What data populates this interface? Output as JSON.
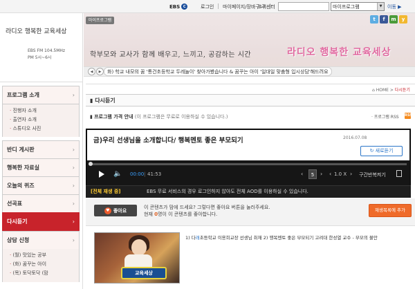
{
  "topbar": {
    "logo": "EBS",
    "links": [
      "로그인",
      "마이페이지/장바구니",
      "고객센터"
    ],
    "program_select": "마이프로그램",
    "go_label": "이동"
  },
  "brand": {
    "title": "라디오 행복한 교육세상",
    "freq_line1": "EBS FM 104.5MHz",
    "freq_line2": "PM 5시~6시"
  },
  "banner": {
    "tag": "마이프로그램",
    "slogan": "학부모와 교사가 함께 배우고, 느끼고, 공감하는 시간",
    "title": "라디오 행복한 교육세상",
    "ticker": "화) 학교 내모의 꿈 '통건초등학교 두레놀이' 찾아가봤습니다 & 꿈꾸는 아이 '일대일 맞춤형 입시상담'해드려요"
  },
  "sidebar": {
    "sections": [
      {
        "label": "프로그램 소개",
        "items": [
          "진행자 소개",
          "출연자 소개",
          "스튜디오 사진"
        ]
      },
      {
        "label": "반디 게시판",
        "items": []
      },
      {
        "label": "행복한 자료실",
        "items": []
      },
      {
        "label": "오늘의 퀴즈",
        "items": []
      },
      {
        "label": "선곡표",
        "items": []
      },
      {
        "label": "다시듣기",
        "items": []
      },
      {
        "label": "상담 신청",
        "items": [
          "(월) 맛있는 공부",
          "(화) 꿈꾸는 아이",
          "(목) 토닥토닥 (맘"
        ]
      }
    ],
    "active": "다시듣기"
  },
  "main": {
    "breadcrumb_home": "HOME",
    "breadcrumb_current": "다시듣기",
    "page_title": "다시듣기",
    "price_bold": "프로그램 가격 안내",
    "price_note": "(이 프로그램은 무료로 이용하실 수 있습니다.)",
    "rss_label": "· 프로그램 RSS",
    "rss_icon": "RSS"
  },
  "player": {
    "episode_title": "금)우리 선생님을 소개합니다/ 행복멘토 좋은 부모되기",
    "date": "2016.07.08",
    "refresh_label": "새로듣기",
    "time_current": "00:00",
    "time_total": "41:53",
    "rate_value": "5",
    "speed": "1.0 X",
    "loop_label": "구간반복켜기",
    "progress_fraction": 0.0
  },
  "notice": {
    "strong": "[전체 재생 중]",
    "text": "EBS 무료 서비스의 경우 로그인하지 않아도 전체 AOD를 이용하실 수 있습니다."
  },
  "like": {
    "button_label": "좋아요",
    "line1": "이 콘텐츠가 맘에 드세요? 그렇다면 좋아요 버튼을 눌러주세요.",
    "line2_pre": "현재",
    "line2_count": "0",
    "line2_post": "명이 이 콘텐츠를 좋아합니다.",
    "add_playlist": "재생목록에 추가"
  },
  "video": {
    "sign_text": "교육세상",
    "title_pre": "1) 다",
    "title_hl": "래",
    "title_post": "초등학교 이용희교장 선생님 취재 2) 행복멘토 좋은 부모되기 고려대 한성열 교수 - 부모의 불안"
  },
  "colors": {
    "accent": "#c8232b",
    "player_bg": "#161616",
    "playlist_btn": "#ef6b2a",
    "link_blue": "#2a75c8"
  }
}
